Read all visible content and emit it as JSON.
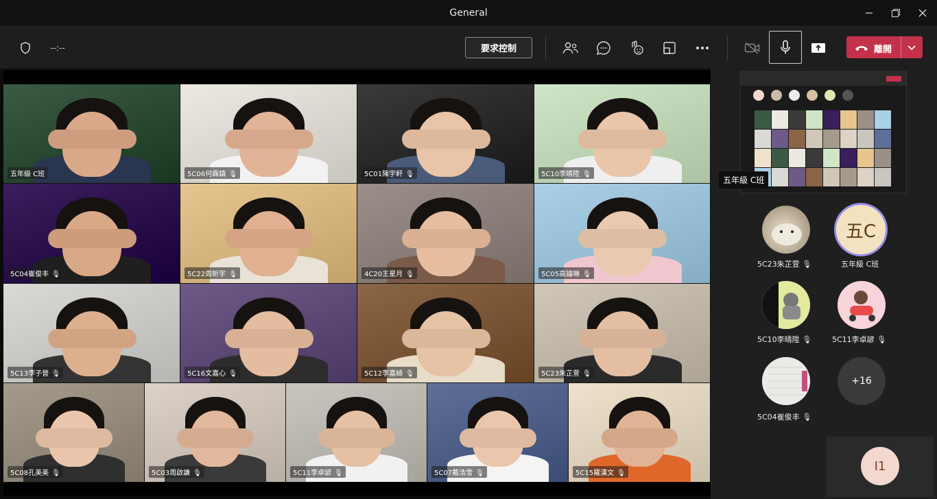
{
  "window": {
    "title": "General"
  },
  "toolbar": {
    "timer": "--:--",
    "request_control": "要求控制",
    "leave": "離開"
  },
  "participants": [
    {
      "name": "五年級 C班"
    },
    {
      "name": "5C06何霖鎮"
    },
    {
      "name": "5C01陳宇軒"
    },
    {
      "name": "5C10李晴陞"
    },
    {
      "name": "5C04崔俊丰"
    },
    {
      "name": "5C22周昕宇"
    },
    {
      "name": "4C20王星月"
    },
    {
      "name": "5C05高鑰琳"
    },
    {
      "name": "5C13李子晉"
    },
    {
      "name": "5C16文嘉心"
    },
    {
      "name": "5C12李嘉綺"
    },
    {
      "name": "5C23朱芷萱"
    },
    {
      "name": "5C08孔美美"
    },
    {
      "name": "5C03周啟謙"
    },
    {
      "name": "5C11李卓諺"
    },
    {
      "name": "5C07戴浩雪"
    },
    {
      "name": "5C15羅漢文"
    }
  ],
  "tooltip": "五年級 C班",
  "roster": [
    {
      "name": "5C23朱芷萱",
      "muted": true
    },
    {
      "name": "五年級 C班",
      "initials": "五C"
    },
    {
      "name": "5C10李晴陞",
      "muted": true
    },
    {
      "name": "5C11李卓諺",
      "muted": true
    },
    {
      "name": "5C04崔俊丰",
      "muted": true
    }
  ],
  "more_count": "+16",
  "self_initials": "I1",
  "colors": {
    "leave": "#c4314b",
    "toolbar": "#1e1e1e",
    "accent": "#9c8ee8"
  }
}
